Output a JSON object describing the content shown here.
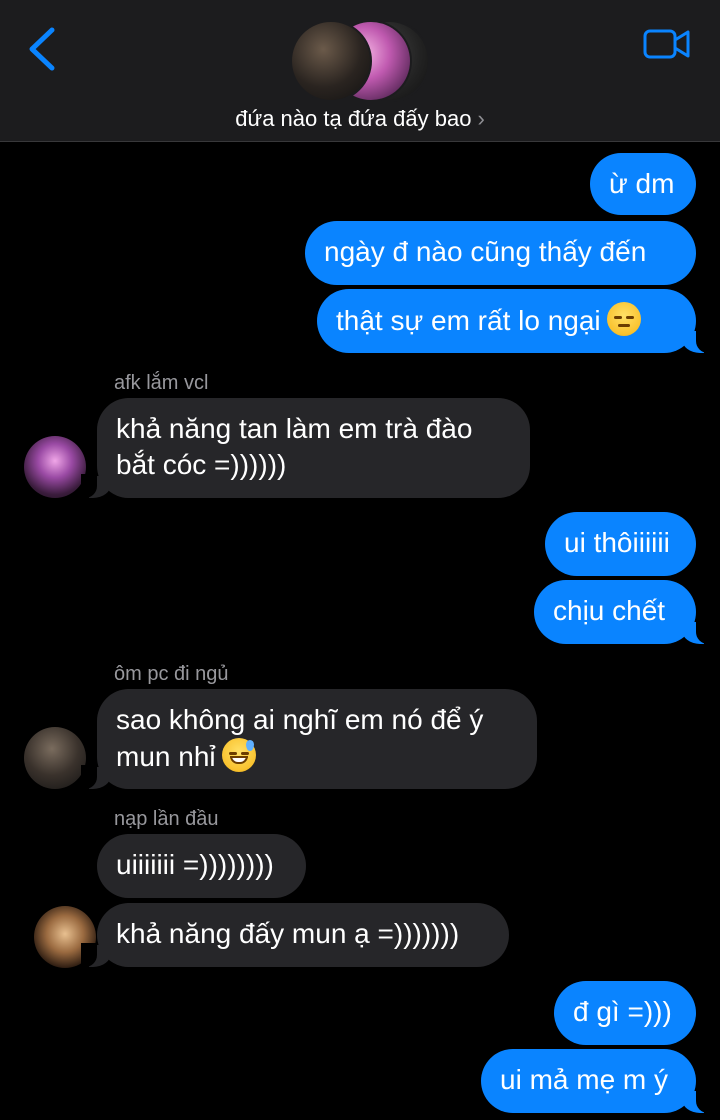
{
  "header": {
    "group_name": "đứa nào tạ đứa đấy bao",
    "chevron": "›",
    "back_icon": "chevron-left-icon",
    "video_icon": "video-camera-icon",
    "accent_color": "#0a84ff"
  },
  "messages": [
    {
      "direction": "out",
      "text": "ừ dm"
    },
    {
      "direction": "out",
      "text": "ngày đ nào cũng thấy đến"
    },
    {
      "direction": "out",
      "text": "thật sự em rất lo ngại",
      "emoji": "pensive-face"
    },
    {
      "direction": "in",
      "sender": "afk lắm vcl",
      "line1": "khả năng tan làm em trà đào",
      "line2": "bắt cóc =))))))"
    },
    {
      "direction": "out",
      "text": "ui thôiiiiii"
    },
    {
      "direction": "out",
      "text": "chịu chết"
    },
    {
      "direction": "in",
      "sender": "ôm pc đi ngủ",
      "line1": "sao không ai nghĩ em nó để ý",
      "line2": "mun nhỉ",
      "emoji": "grinning-sweat-face"
    },
    {
      "direction": "in",
      "sender": "nạp lần đầu",
      "text": "uiiiiiii =))))))))"
    },
    {
      "direction": "in",
      "text": "khả năng đấy mun ạ =)))))))"
    },
    {
      "direction": "out",
      "text": "đ gì =)))"
    },
    {
      "direction": "out",
      "text": "ui mả mẹ m ý"
    }
  ]
}
